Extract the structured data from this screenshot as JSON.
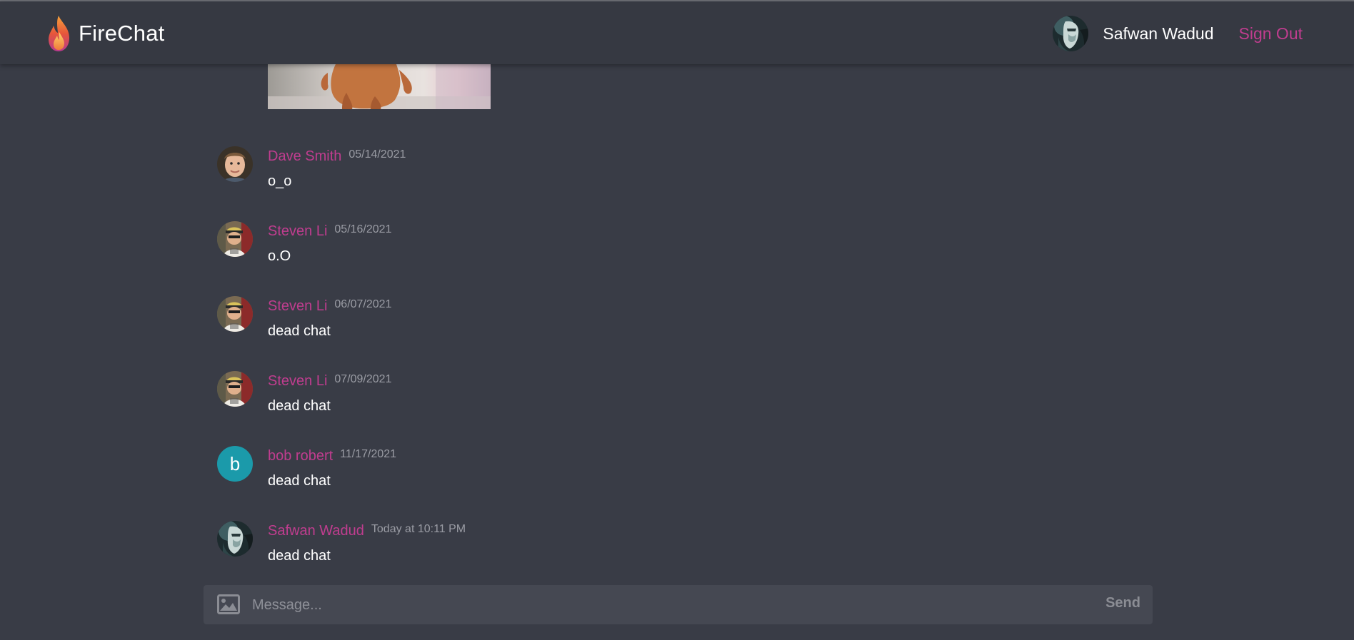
{
  "app": {
    "name": "FireChat",
    "accent_color": "#c03d8f"
  },
  "header": {
    "user_name": "Safwan Wadud",
    "sign_out_label": "Sign Out"
  },
  "messages": [
    {
      "author": "Dave Smith",
      "time": "05/14/2021",
      "text": "o_o",
      "avatar": "photo-dave"
    },
    {
      "author": "Steven Li",
      "time": "05/16/2021",
      "text": "o.O",
      "avatar": "photo-steven"
    },
    {
      "author": "Steven Li",
      "time": "06/07/2021",
      "text": "dead chat",
      "avatar": "photo-steven"
    },
    {
      "author": "Steven Li",
      "time": "07/09/2021",
      "text": "dead chat",
      "avatar": "photo-steven"
    },
    {
      "author": "bob robert",
      "time": "11/17/2021",
      "text": "dead chat",
      "avatar": "letter",
      "avatar_letter": "b",
      "avatar_color": "#1b9aaa"
    },
    {
      "author": "Safwan Wadud",
      "time": "Today at 10:11 PM",
      "text": "dead chat",
      "avatar": "photo-safwan"
    }
  ],
  "composer": {
    "placeholder": "Message...",
    "send_label": "Send",
    "image_icon": "image-icon"
  }
}
